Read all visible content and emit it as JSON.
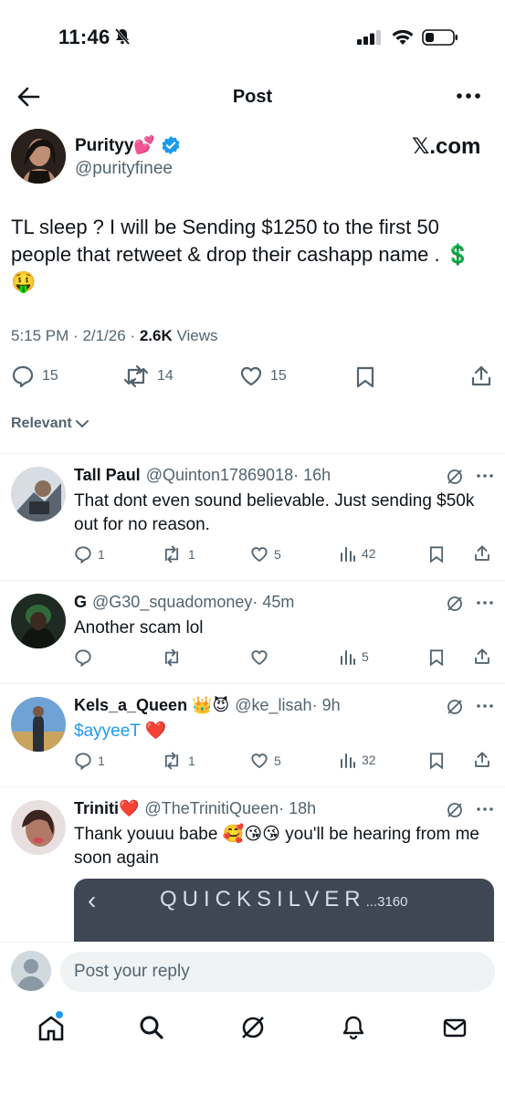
{
  "status_bar": {
    "time": "11:46"
  },
  "header": {
    "title": "Post"
  },
  "post": {
    "name": "Purityy💕",
    "handle": "@purityfinee",
    "brand": "𝕏.com",
    "text": "TL sleep ? I will be Sending $1250 to the first 50 people that retweet & drop their cashapp name . 💲🤑",
    "time": "5:15 PM",
    "date": "2/1/26",
    "views_count": "2.6K",
    "views_label": "Views",
    "replies": "15",
    "reposts": "14",
    "likes": "15"
  },
  "sort": {
    "label": "Relevant"
  },
  "replies": [
    {
      "name": "Tall Paul",
      "handle": "@Quinton17869018",
      "time": "· 16h",
      "text": "That dont even sound believable. Just sending $50k out for no reason.",
      "replies": "1",
      "reposts": "1",
      "likes": "5",
      "views": "42"
    },
    {
      "name": "G",
      "handle": "@G30_squadomoney",
      "time": "· 45m",
      "text": "Another scam lol",
      "replies": "",
      "reposts": "",
      "likes": "",
      "views": "5"
    },
    {
      "name": "Kels_a_Queen 👑😈",
      "handle": "@ke_lisah",
      "time": "· 9h",
      "text_link": "$ayyeeT",
      "text_emoji": "❤️",
      "replies": "1",
      "reposts": "1",
      "likes": "5",
      "views": "32"
    },
    {
      "name": "Triniti❤️",
      "handle": "@TheTrinitiQueen",
      "time": "· 18h",
      "text": "Thank youuu babe 🥰😘😘  you'll be hearing from me soon again",
      "card_title": "QUICKSILVER",
      "card_sub": "...3160"
    }
  ],
  "composer": {
    "placeholder": "Post your reply"
  },
  "nav": {
    "items": [
      "home-icon",
      "search-icon",
      "grok-icon",
      "notifications-icon",
      "messages-icon"
    ]
  },
  "colors": {
    "accent": "#1d9bf0",
    "text": "#0f1419",
    "muted": "#536471"
  }
}
